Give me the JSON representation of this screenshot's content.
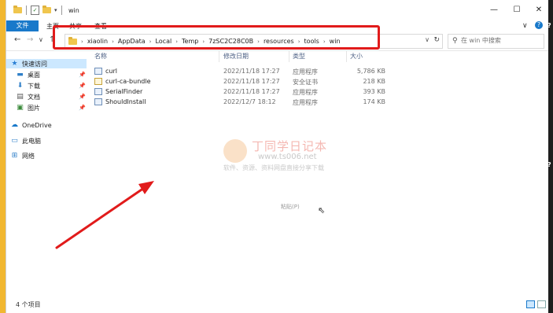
{
  "window": {
    "title": "win",
    "quick_access_icons": [
      "folder-icon",
      "checkbox-icon",
      "folder-icon",
      "dropdown-arrow-icon"
    ],
    "controls": {
      "minimize": "—",
      "maximize": "☐",
      "close": "✕"
    }
  },
  "ribbon": {
    "tabs": [
      "文件",
      "主页",
      "共享",
      "查看"
    ],
    "collapse_glyph": "∨",
    "help_glyph": "?"
  },
  "address_bar": {
    "crumbs": [
      "xiaolin",
      "AppData",
      "Local",
      "Temp",
      "7zSC2C28C0B",
      "resources",
      "tools",
      "win"
    ],
    "separator": "›",
    "highlight_color": "#e11b1b"
  },
  "nav_buttons": {
    "back": "←",
    "forward": "→",
    "recent": "∨",
    "up": "↑"
  },
  "search": {
    "placeholder": "在 win 中搜索"
  },
  "nav_pane": {
    "items": [
      {
        "label": "快速访问",
        "icon": "star-icon",
        "selected": true
      },
      {
        "label": "桌面",
        "icon": "desktop-icon",
        "pinned": true
      },
      {
        "label": "下载",
        "icon": "download-icon",
        "pinned": true
      },
      {
        "label": "文档",
        "icon": "document-icon",
        "pinned": true
      },
      {
        "label": "图片",
        "icon": "picture-icon",
        "pinned": true
      },
      {
        "label": "OneDrive",
        "icon": "cloud-icon"
      },
      {
        "label": "此电脑",
        "icon": "computer-icon"
      },
      {
        "label": "网络",
        "icon": "network-icon"
      }
    ]
  },
  "file_list": {
    "columns": [
      "名称",
      "修改日期",
      "类型",
      "大小"
    ],
    "rows": [
      {
        "name": "curl",
        "date": "2022/11/18 17:27",
        "type": "应用程序",
        "size": "5,786 KB",
        "icon": "exe-icon"
      },
      {
        "name": "curl-ca-bundle",
        "date": "2022/11/18 17:27",
        "type": "安全证书",
        "size": "218 KB",
        "icon": "certificate-icon"
      },
      {
        "name": "SerialFinder",
        "date": "2022/11/18 17:27",
        "type": "应用程序",
        "size": "393 KB",
        "icon": "exe-icon"
      },
      {
        "name": "ShouldInstall",
        "date": "2022/12/7 18:12",
        "type": "应用程序",
        "size": "174 KB",
        "icon": "exe-icon"
      }
    ]
  },
  "context_hint": "粘贴(P)",
  "watermark": {
    "title": "丁同学日记本",
    "url": "www.ts006.net",
    "desc": "软件、资源、资料网盘直接分享下载"
  },
  "status_bar": {
    "item_count": "4 个项目"
  }
}
